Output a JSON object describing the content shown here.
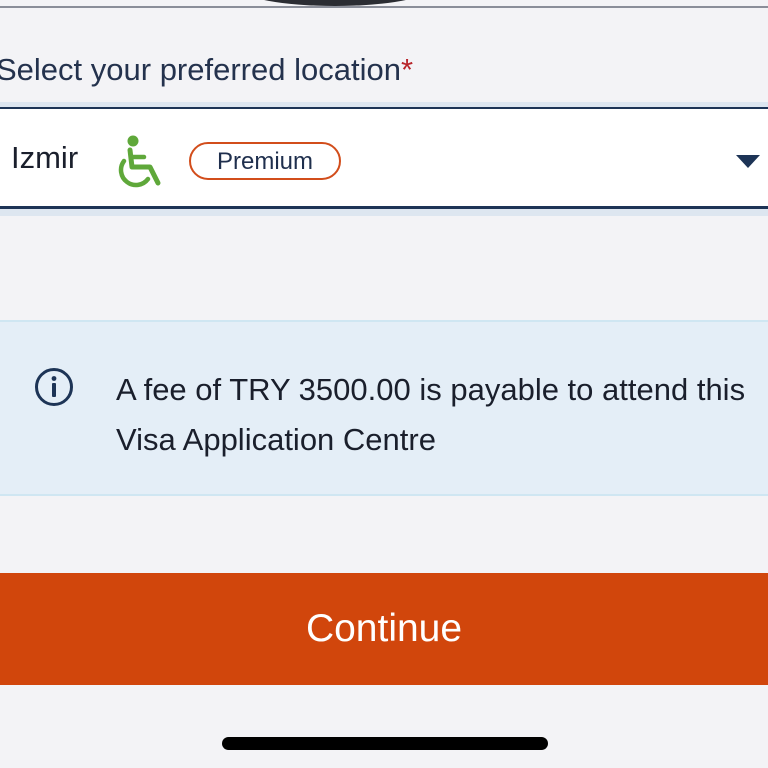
{
  "location_field": {
    "label": "Select your preferred location",
    "required_marker": "*",
    "selected_value": "Izmir",
    "accessibility_icon": "wheelchair-icon",
    "badge": "Premium",
    "dropdown_icon": "caret-down-icon"
  },
  "info_notice": {
    "icon": "info-icon",
    "text": "A fee of TRY 3500.00 is payable to attend this Visa Application Centre"
  },
  "actions": {
    "continue_label": "Continue"
  },
  "colors": {
    "accent": "#d1460c",
    "navy": "#1d3456",
    "accessibility_green": "#5fa83a",
    "info_background": "#e4eef7",
    "required": "#b8242a"
  }
}
